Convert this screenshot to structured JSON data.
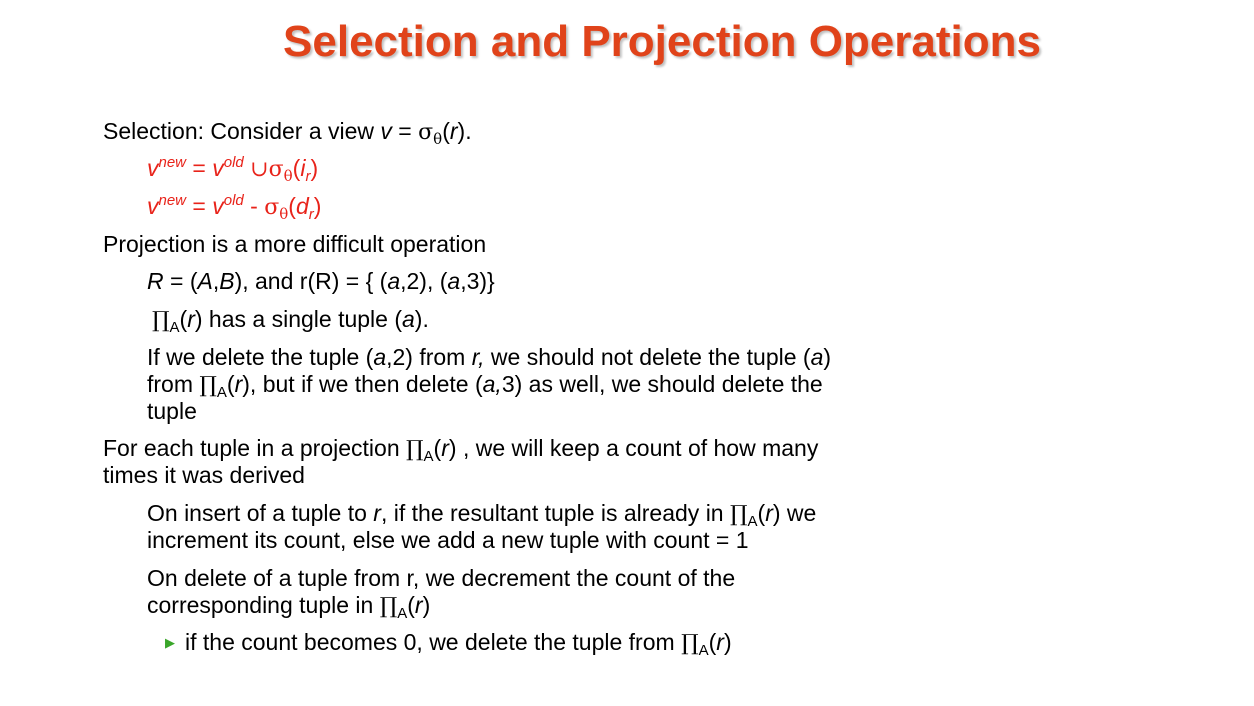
{
  "slide": {
    "title": "Selection and Projection Operations",
    "accent_color": "#e0431a",
    "bullet_color": "#3aa62a",
    "bullet_icon": "triangle-right-icon",
    "sel_intro_prefix": "Selection: Consider a view ",
    "sel_intro_v": "v",
    "sel_intro_eq": " = ",
    "sigma": "σ",
    "theta": "θ",
    "sel_intro_r": "r",
    "sel_intro_tail": ").",
    "v": "v",
    "new_label": "new",
    "old_label": "old",
    "eq_sign": " = ",
    "union": "∪",
    "minus": " - ",
    "i_letter": "i",
    "d_letter": "d",
    "r_sub": "r",
    "proj_heading": "Projection is a more difficult operation",
    "relation_line": {
      "R": "R",
      "open": " = (",
      "A": "A",
      "comma": ",",
      "B": "B",
      "mid": "), and r(R) = { (",
      "a1": "a",
      "val1": ",2), (",
      "a2": "a",
      "val2": ",3)}"
    },
    "pi": "∏",
    "A_sub": "A",
    "r": "r",
    "single_tuple_mid": ") has a single tuple (",
    "a": "a",
    "single_tuple_end": ").",
    "delete_p1": "If we delete the tuple (",
    "delete_p1_val": ",2) from ",
    "delete_p1_r": "r,",
    "delete_p1_tail": " we should not delete the tuple (",
    "delete_p1_end": ")",
    "delete_p2_from": "from ",
    "delete_p2_mid": "), but if we then delete (",
    "delete_p2_a": "a,",
    "delete_p2_tail": "3) as well, we should delete the",
    "delete_p3": "tuple",
    "count_p1": "For each tuple in a projection ",
    "count_p1_tail": ") , we will keep a count of how many",
    "count_p2": "times it was derived",
    "insert_p1": "On insert of a tuple to ",
    "insert_p1_mid": ", if the resultant tuple is already in ",
    "insert_p1_tail": ") we",
    "insert_p2": "increment its count, else we add a new tuple with count = 1",
    "del_count_p1": "On delete of a tuple from r, we decrement the count of the",
    "del_count_p2": "corresponding tuple in ",
    "zero_text": "if the count becomes 0, we delete the tuple from "
  }
}
